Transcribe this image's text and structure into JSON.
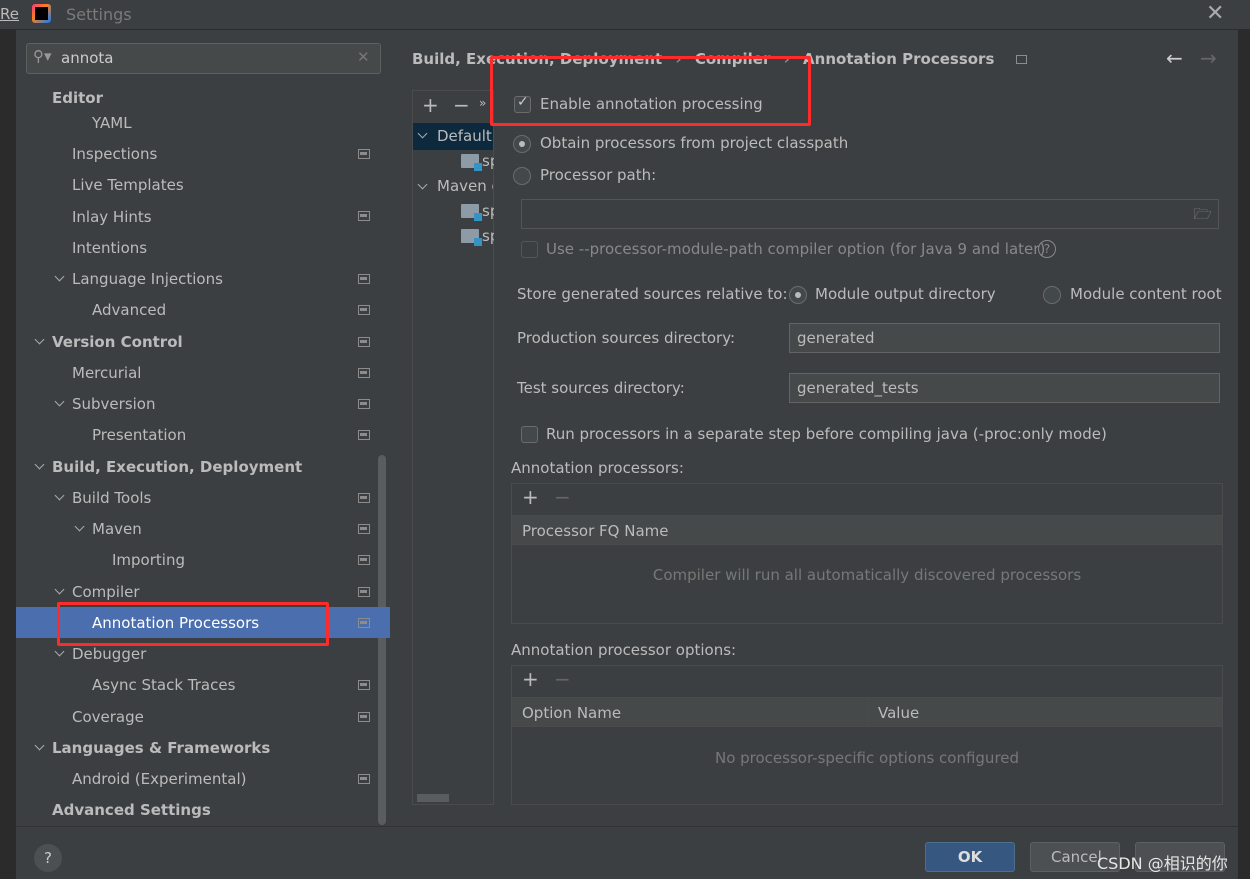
{
  "window": {
    "title": "Settings",
    "left_edge_text": "Re",
    "close_icon": "close-icon"
  },
  "search": {
    "value": "annota"
  },
  "sidebar": {
    "items": [
      {
        "label": "Editor"
      },
      {
        "label": "YAML"
      },
      {
        "label": "Inspections"
      },
      {
        "label": "Live Templates"
      },
      {
        "label": "Inlay Hints"
      },
      {
        "label": "Intentions"
      },
      {
        "label": "Language Injections"
      },
      {
        "label": "Advanced"
      },
      {
        "label": "Version Control"
      },
      {
        "label": "Mercurial"
      },
      {
        "label": "Subversion"
      },
      {
        "label": "Presentation"
      },
      {
        "label": "Build, Execution, Deployment"
      },
      {
        "label": "Build Tools"
      },
      {
        "label": "Maven"
      },
      {
        "label": "Importing"
      },
      {
        "label": "Compiler"
      },
      {
        "label": "Annotation Processors"
      },
      {
        "label": "Debugger"
      },
      {
        "label": "Async Stack Traces"
      },
      {
        "label": "Coverage"
      },
      {
        "label": "Languages & Frameworks"
      },
      {
        "label": "Android (Experimental)"
      },
      {
        "label": "Advanced Settings"
      }
    ]
  },
  "breadcrumb": {
    "items": [
      "Build, Execution, Deployment",
      "Compiler",
      "Annotation Processors"
    ]
  },
  "profiles": {
    "items": [
      "Default",
      "sp",
      "Maven d",
      "sp",
      "sp"
    ]
  },
  "settings": {
    "enable": "Enable annotation processing",
    "obtain": "Obtain processors from project classpath",
    "processor_path": "Processor path:",
    "processor_path_value": "",
    "module_path": "Use --processor-module-path compiler option (for Java 9 and later)",
    "store_label": "Store generated sources relative to:",
    "module_output": "Module output directory",
    "module_content": "Module content root",
    "prod_label": "Production sources directory:",
    "prod_value": "generated",
    "test_label": "Test sources directory:",
    "test_value": "generated_tests",
    "run_separate": "Run processors in a separate step before compiling java (-proc:only mode)",
    "processors_label": "Annotation processors:",
    "processors_col": "Processor FQ Name",
    "processors_empty": "Compiler will run all automatically discovered processors",
    "options_label": "Annotation processor options:",
    "options_col1": "Option Name",
    "options_col2": "Value",
    "options_empty": "No processor-specific options configured"
  },
  "footer": {
    "ok": "OK",
    "cancel": "Cancel",
    "apply": "",
    "help": "?"
  },
  "watermark": "CSDN @相识的你"
}
